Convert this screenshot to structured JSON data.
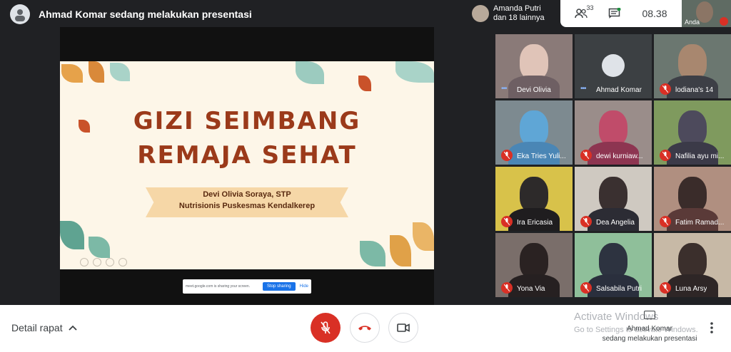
{
  "header": {
    "presenter_title": "Ahmad Komar sedang melakukan presentasi",
    "participants_chip_line1": "Amanda Putri",
    "participants_chip_line2": "dan 18 lainnya",
    "people_count": "33",
    "clock": "08.38",
    "self_label": "Anda"
  },
  "slide": {
    "title_line1": "GIZI SEIMBANG",
    "title_line2": "REMAJA SEHAT",
    "presenter_name": "Devi Olivia Soraya, STP",
    "presenter_role": "Nutrisionis Puskesmas Kendalkerep"
  },
  "share_bar": {
    "text": "meet.google.com is sharing your screen.",
    "stop_label": "Stop sharing",
    "hide_label": "Hide"
  },
  "grid": {
    "tiles": [
      {
        "name": "Devi Olivia"
      },
      {
        "name": "Ahmad Komar"
      },
      {
        "name": "lodiana's 14"
      },
      {
        "name": "Eka Tries Yuli..."
      },
      {
        "name": "dewi kurniaw..."
      },
      {
        "name": "Nafilia ayu mi..."
      },
      {
        "name": "Ira Ericasia"
      },
      {
        "name": "Dea Angelia"
      },
      {
        "name": "Fatim Ramad..."
      },
      {
        "name": "Yona Via"
      },
      {
        "name": "Salsabila Putri"
      },
      {
        "name": "Luna Arsy"
      }
    ]
  },
  "bottom": {
    "details_label": "Detail rapat",
    "activate_line1": "Activate Windows",
    "activate_line2": "Go to Settings to activate Windows.",
    "present_line1": "Ahmad Komar",
    "present_line2": "sedang melakukan presentasi"
  },
  "colors": {
    "mic_off": "#d93025",
    "accent": "#1a73e8",
    "slide_title": "#9b3a1a"
  }
}
